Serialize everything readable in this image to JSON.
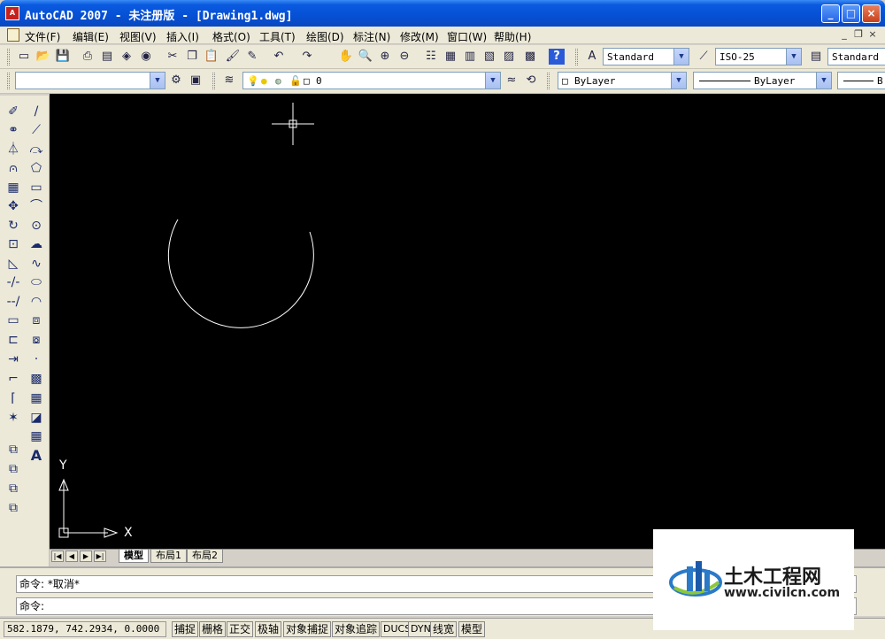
{
  "window": {
    "title": "AutoCAD 2007 - 未注册版 - [Drawing1.dwg]",
    "app_icon_text": "A",
    "minimize": "_",
    "maximize": "□",
    "close": "×"
  },
  "menu": {
    "items": [
      "文件(F)",
      "编辑(E)",
      "视图(V)",
      "插入(I)",
      "格式(O)",
      "工具(T)",
      "绘图(D)",
      "标注(N)",
      "修改(M)",
      "窗口(W)",
      "帮助(H)"
    ],
    "mdi_minimize": "_",
    "mdi_restore": "❐",
    "mdi_close": "×"
  },
  "styles_toolbar": {
    "text_style": "Standard",
    "dim_style": "ISO-25",
    "table_style": "Standard"
  },
  "properties_toolbar": {
    "workspace": "",
    "layer": "0",
    "color": "ByLayer",
    "linetype": "ByLayer",
    "lineweight_short": "B"
  },
  "ucs": {
    "x_label": "X",
    "y_label": "Y"
  },
  "layout_tabs": [
    "模型",
    "布局1",
    "布局2"
  ],
  "command": {
    "history": "命令: *取消*",
    "prompt": "命令:"
  },
  "status": {
    "coords": "582.1879, 742.2934, 0.0000",
    "toggles": [
      "捕捉",
      "栅格",
      "正交",
      "极轴",
      "对象捕捉",
      "对象追踪",
      "DUCS",
      "DYN",
      "线宽",
      "模型"
    ]
  },
  "watermark": {
    "name": "土木工程网",
    "url": "www.civilcn.com"
  },
  "colors": {
    "canvas": "#000000",
    "drawing_line": "#ffffff",
    "titlebar": "#0550d4"
  }
}
